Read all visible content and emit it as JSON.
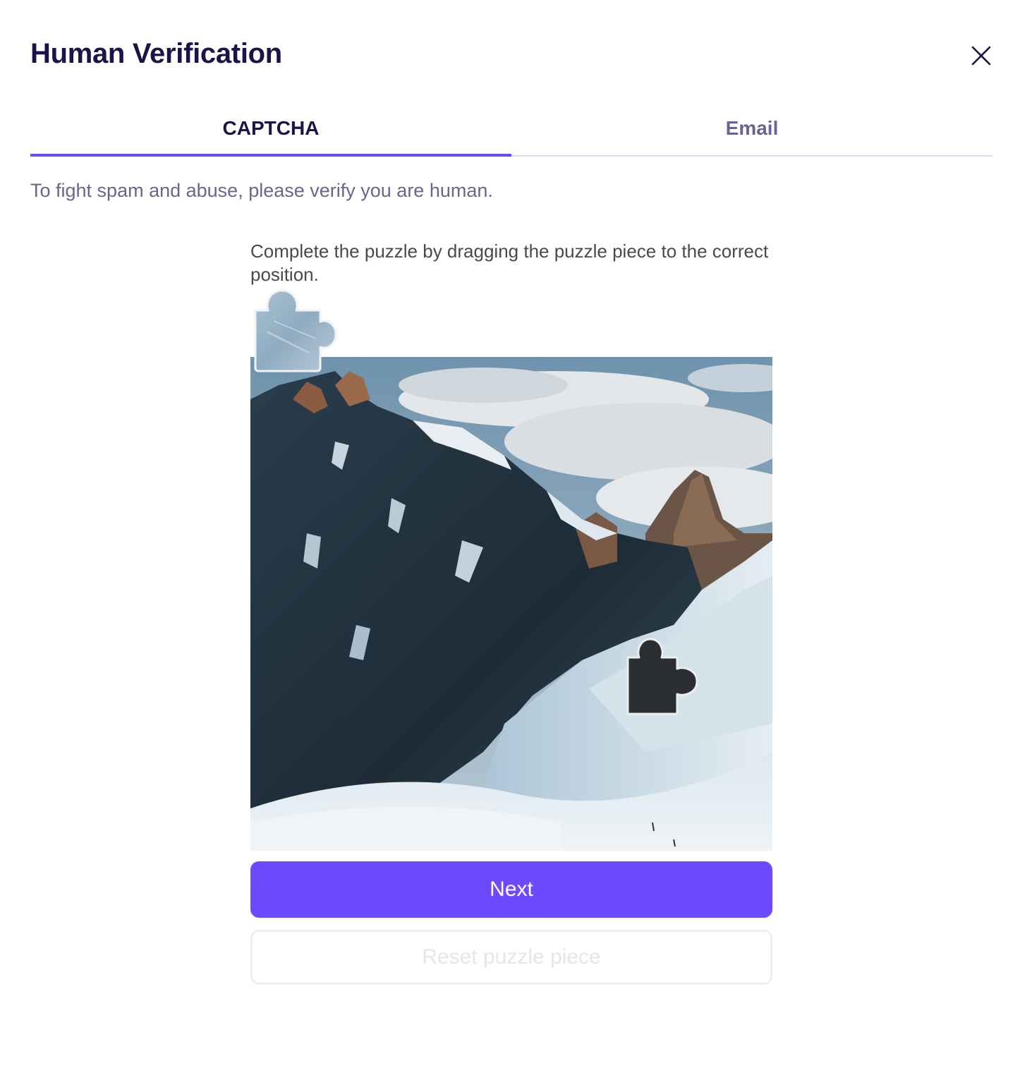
{
  "dialog": {
    "title": "Human Verification",
    "close_icon": "close-icon"
  },
  "tabs": [
    {
      "label": "CAPTCHA",
      "active": true
    },
    {
      "label": "Email",
      "active": false
    }
  ],
  "intro_text": "To fight spam and abuse, please verify you are human.",
  "captcha": {
    "instructions": "Complete the puzzle by dragging the puzzle piece to the correct position.",
    "image_icon": "mountain-landscape",
    "piece_icon": "puzzle-piece-icon",
    "slot_icon": "puzzle-slot-icon"
  },
  "buttons": {
    "next_label": "Next",
    "reset_label": "Reset puzzle piece"
  },
  "colors": {
    "accent": "#6d4aff",
    "title": "#1b1448",
    "muted": "#6a6590"
  }
}
